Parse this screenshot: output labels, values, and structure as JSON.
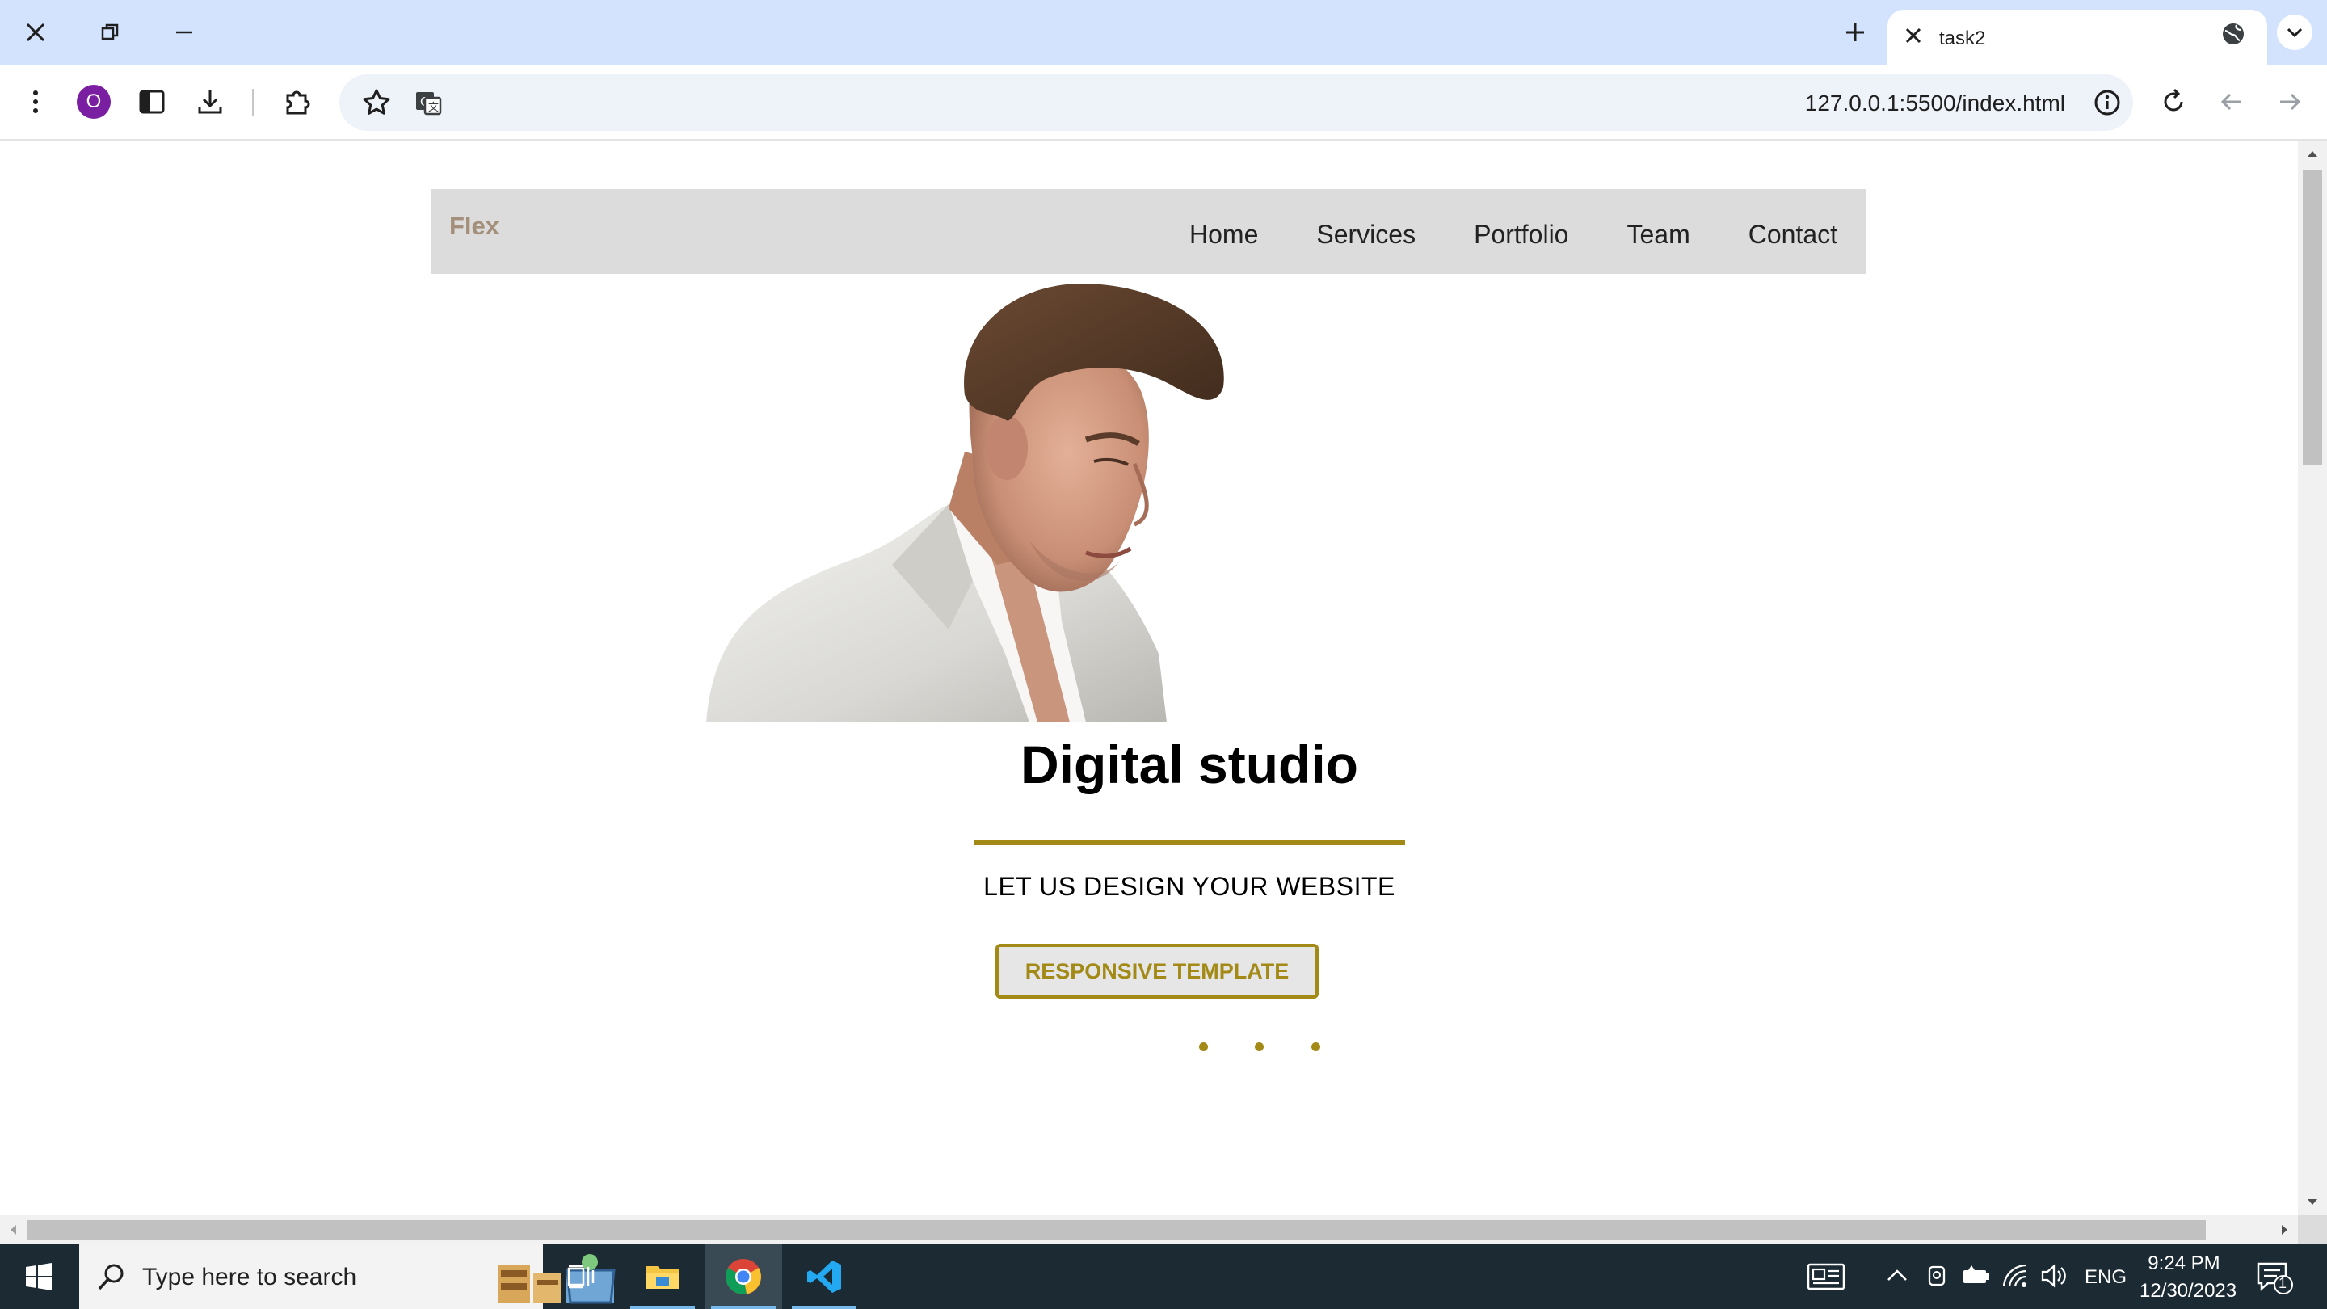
{
  "browser": {
    "tab_title": "task2",
    "url": "127.0.0.1:5500/index.html",
    "profile_initial": "O"
  },
  "site": {
    "brand": "Flex",
    "nav": [
      "Home",
      "Services",
      "Portfolio",
      "Team",
      "Contact"
    ],
    "headline": "Digital studio",
    "subtitle": "LET US DESIGN YOUR WEBSITE",
    "cta_label": "RESPONSIVE TEMPLATE",
    "accent_color": "#a38a16",
    "carousel_dots": 3
  },
  "taskbar": {
    "search_placeholder": "Type here to search",
    "language": "ENG",
    "time": "9:24 PM",
    "date": "12/30/2023",
    "notification_count": "1"
  },
  "colors": {
    "tabstrip": "#d3e3fd",
    "navbar_bg": "#dcdcdc",
    "taskbar_bg": "#1b2a33"
  }
}
